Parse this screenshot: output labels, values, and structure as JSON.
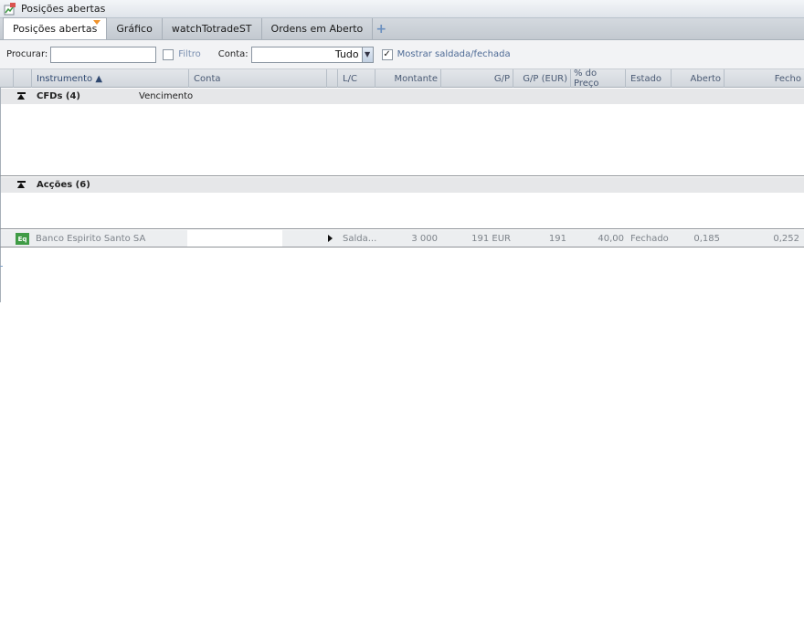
{
  "window": {
    "title": "Posições abertas"
  },
  "tabs": [
    {
      "label": "Posições abertas",
      "active": true
    },
    {
      "label": "Gráfico"
    },
    {
      "label": "watchTotradeST"
    },
    {
      "label": "Ordens em Aberto"
    }
  ],
  "toolbar": {
    "search_label": "Procurar:",
    "search_value": "",
    "filter_label": "Filtro",
    "filter_checked": false,
    "account_label": "Conta:",
    "account_value": "Tudo",
    "show_closed_label": "Mostrar saldada/fechada",
    "show_closed_checked": true,
    "checkmark": "✓"
  },
  "columns": {
    "instrument": "Instrumento ▲",
    "account": "Conta",
    "lc": "L/C",
    "amount": "Montante",
    "pl": "G/P",
    "pl_eur": "G/P (EUR)",
    "pct_price": "% do Preço",
    "status": "Estado",
    "open": "Aberto",
    "close": "Fecho"
  },
  "groups": [
    {
      "title": "CFDs (4)",
      "subtitle": "Vencimento"
    },
    {
      "title": "Acções (6)"
    }
  ],
  "rows": [
    {
      "icon": "Eq",
      "instrument": "Banco Espirito Santo SA",
      "lc": "Salda...",
      "amount": "3 000",
      "pl": "191 EUR",
      "pl_eur": "191",
      "pct_price": "40,00",
      "status": "Fechado",
      "open": "0,185",
      "close": "0,252"
    }
  ],
  "colors": {
    "accent": "#f0932b",
    "instrument_icon": "#3f9b45",
    "link": "#4d6a95"
  }
}
